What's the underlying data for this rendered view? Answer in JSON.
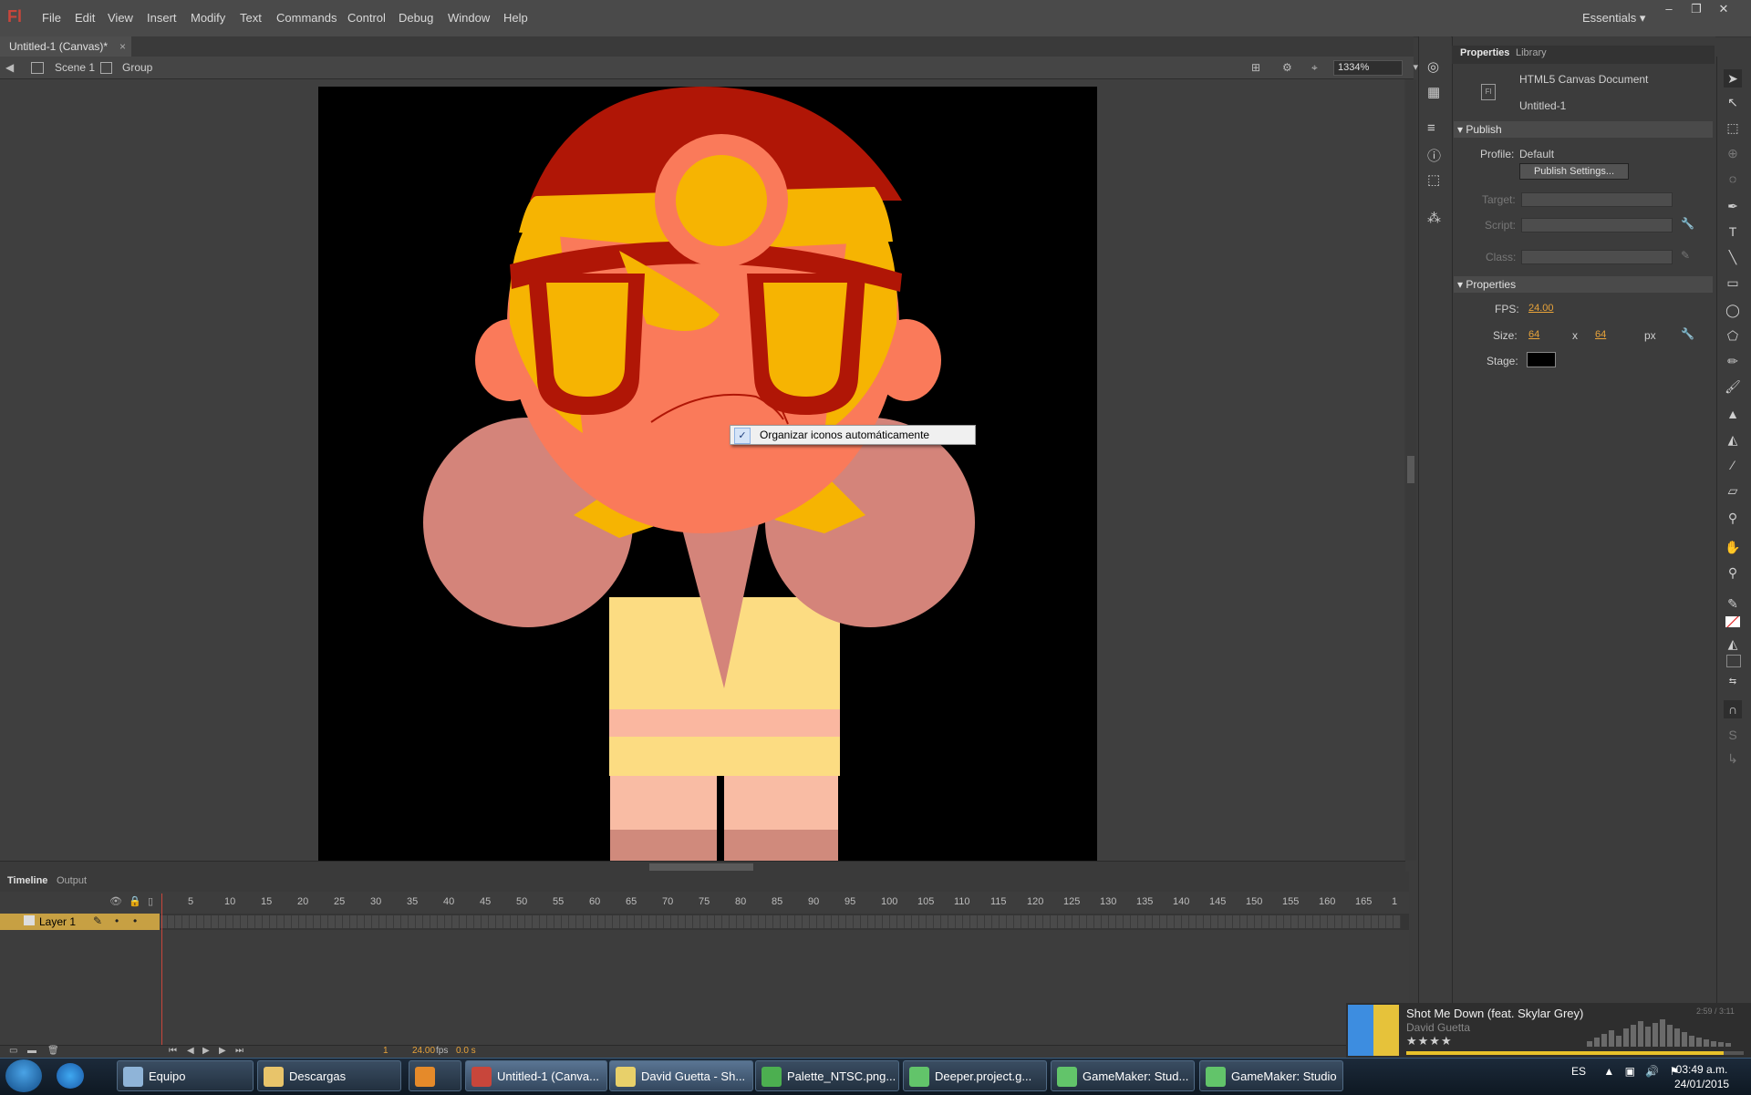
{
  "app": {
    "logo": "Fl",
    "menu": [
      "File",
      "Edit",
      "View",
      "Insert",
      "Modify",
      "Text",
      "Commands",
      "Control",
      "Debug",
      "Window",
      "Help"
    ],
    "workspace": "Essentials",
    "window_controls": [
      "–",
      "❐",
      "✕"
    ]
  },
  "document": {
    "tab_title": "Untitled-1 (Canvas)*",
    "tab_close": "×",
    "breadcrumb": {
      "scene": "Scene 1",
      "group": "Group"
    },
    "zoom": "1334%"
  },
  "context_menu": {
    "checked": true,
    "check_glyph": "✓",
    "label": "Organizar iconos automáticamente"
  },
  "timeline": {
    "tabs": [
      "Timeline",
      "Output"
    ],
    "layer_name": "Layer 1",
    "frame_ticks": [
      "5",
      "10",
      "15",
      "20",
      "25",
      "30",
      "35",
      "40",
      "45",
      "50",
      "55",
      "60",
      "65",
      "70",
      "75",
      "80",
      "85",
      "90",
      "95",
      "100",
      "105",
      "110",
      "115",
      "120",
      "125",
      "130",
      "135",
      "140",
      "145",
      "150",
      "155",
      "160",
      "165",
      "1"
    ],
    "current_frame": "1",
    "fps_display": "24.00",
    "fps_unit": "fps",
    "elapsed": "0.0 s"
  },
  "properties_panel": {
    "tabs": [
      "Properties",
      "Library"
    ],
    "doc_type": "HTML5 Canvas Document",
    "doc_name": "Untitled-1",
    "publish": {
      "header": "Publish",
      "profile_label": "Profile:",
      "profile_value": "Default",
      "settings_button": "Publish Settings...",
      "target_label": "Target:",
      "script_label": "Script:",
      "class_label": "Class:"
    },
    "properties": {
      "header": "Properties",
      "fps_label": "FPS:",
      "fps_value": "24.00",
      "size_label": "Size:",
      "width": "64",
      "x_sep": "x",
      "height": "64",
      "unit": "px",
      "stage_label": "Stage:",
      "stage_color": "#000000"
    }
  },
  "media_player": {
    "title": "Shot Me Down (feat. Skylar Grey)",
    "artist": "David Guetta",
    "rating_stars": "★★★★",
    "time": "2:59 / 3:11",
    "progress": 0.94
  },
  "taskbar": {
    "items": [
      {
        "label": "Equipo",
        "icon": "computer-icon"
      },
      {
        "label": "Descargas",
        "icon": "folder-icon"
      },
      {
        "label": "",
        "icon": "media-player-icon"
      },
      {
        "label": "Untitled-1 (Canva...",
        "icon": "flash-icon"
      },
      {
        "label": "David Guetta - Sh...",
        "icon": "music-app-icon"
      },
      {
        "label": "Palette_NTSC.png...",
        "icon": "chrome-icon"
      },
      {
        "label": "Deeper.project.g...",
        "icon": "gamemaker-icon"
      },
      {
        "label": "GameMaker: Stud...",
        "icon": "gamemaker-icon"
      },
      {
        "label": "GameMaker: Studio",
        "icon": "gamemaker-icon"
      }
    ],
    "language": "ES",
    "time": "03:49 a.m.",
    "date": "24/01/2015"
  },
  "colors": {
    "accent": "#c7a043",
    "flash_red": "#c8463b",
    "skin": "#fa7a5a",
    "hair": "#f6b402",
    "headband": "#b01606",
    "cheek": "#d4847a",
    "shirt": "#fcdc82"
  }
}
